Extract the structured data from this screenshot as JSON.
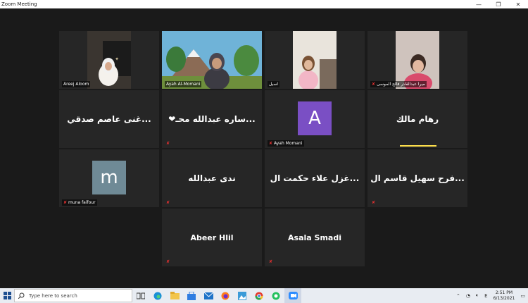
{
  "window": {
    "title": "Zoom Meeting",
    "controls": [
      "—",
      "❐",
      "✕"
    ]
  },
  "participants": [
    {
      "name": "Areej Aloom",
      "video": true,
      "muted": false
    },
    {
      "name": "Ayah Al-Momani",
      "video": true,
      "muted": false,
      "active": true
    },
    {
      "name": "اسيل",
      "video": true,
      "muted": false
    },
    {
      "name": "ميرا عبدالقادر فالح الموسى",
      "video": true,
      "muted": true
    },
    {
      "display": "غنى عاصم صدقي...",
      "name": "",
      "muted": false
    },
    {
      "display": "❤ساره عبدالله محـ...",
      "name": "",
      "muted": true
    },
    {
      "avatar_letter": "A",
      "avatar_color": "#7a4fc4",
      "name": "Ayah Momani",
      "muted": true
    },
    {
      "display": "رهام مالك",
      "name": "",
      "muted": false,
      "speaking": true
    },
    {
      "avatar_letter": "m",
      "avatar_color": "#6f8a96",
      "name": "muna faifour",
      "muted": true
    },
    {
      "display": "ندى عبدالله",
      "name": "",
      "muted": true
    },
    {
      "display": "غزل علاء حكمت ال...",
      "name": "",
      "muted": false
    },
    {
      "display": "فرح سهيل قاسم ال...",
      "name": "",
      "muted": true
    },
    {
      "display": "Abeer Hlil",
      "name": "",
      "muted": true
    },
    {
      "display": "Asala Smadi",
      "name": "",
      "muted": true
    }
  ],
  "taskbar": {
    "search_placeholder": "Type here to search",
    "apps": [
      "task-view",
      "edge",
      "file-explorer",
      "store",
      "mail",
      "firefox",
      "photos",
      "chrome",
      "whatsapp",
      "zoom"
    ],
    "tray": {
      "lang": "E",
      "time": "2:51 PM",
      "date": "6/13/2021"
    }
  }
}
